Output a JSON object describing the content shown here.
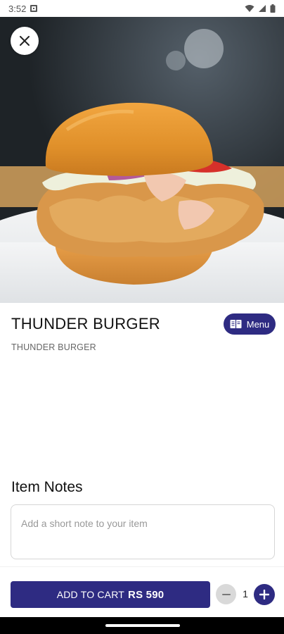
{
  "status_bar": {
    "time": "3:52"
  },
  "item": {
    "title": "THUNDER BURGER",
    "subtitle": "THUNDER BURGER",
    "image_icon": "burger-photo"
  },
  "menu_button": {
    "label": "Menu",
    "icon": "book-icon"
  },
  "notes": {
    "title": "Item Notes",
    "placeholder": "Add a short note to your item",
    "value": ""
  },
  "cart": {
    "add_label": "ADD TO CART",
    "price": "RS 590",
    "quantity": "1"
  },
  "colors": {
    "primary": "#2e2b82",
    "minus_button": "#d9d9d9"
  }
}
